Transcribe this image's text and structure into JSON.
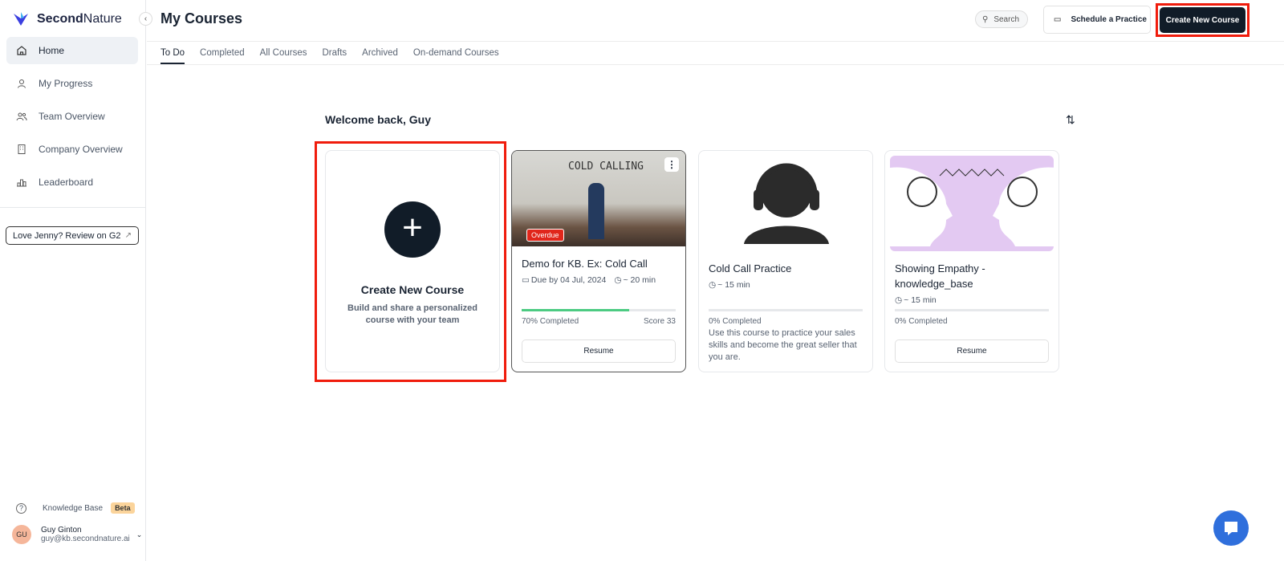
{
  "brand": {
    "name_bold": "Second",
    "name_rest": "Nature"
  },
  "sidebar": {
    "items": [
      {
        "label": "Home"
      },
      {
        "label": "My Progress"
      },
      {
        "label": "Team Overview"
      },
      {
        "label": "Company Overview"
      },
      {
        "label": "Leaderboard"
      }
    ],
    "review_label": "Love Jenny? Review on G2",
    "knowledge_base": "Knowledge Base",
    "beta": "Beta",
    "user": {
      "initials": "GU",
      "name": "Guy Ginton",
      "email": "guy@kb.secondnature.ai"
    }
  },
  "header": {
    "title": "My Courses",
    "search": "Search",
    "schedule": "Schedule a Practice",
    "create": "Create New Course"
  },
  "tabs": [
    {
      "label": "To Do"
    },
    {
      "label": "Completed"
    },
    {
      "label": "All Courses"
    },
    {
      "label": "Drafts"
    },
    {
      "label": "Archived"
    },
    {
      "label": "On-demand Courses"
    }
  ],
  "main": {
    "welcome": "Welcome back, Guy",
    "create_card": {
      "title": "Create New Course",
      "desc": "Build and share a personalized course with your team"
    },
    "courses": [
      {
        "title": "Demo for KB. Ex: Cold Call",
        "badge": "Overdue",
        "due": "Due by 04 Jul, 2024",
        "duration": "~ 20 min",
        "progress": 70,
        "progress_label": "70% Completed",
        "score": "Score 33",
        "button": "Resume",
        "image_text": "COLD CALLING"
      },
      {
        "title": "Cold Call Practice",
        "duration": "~ 15 min",
        "progress": 0,
        "progress_label": "0% Completed",
        "desc": "Use this course to practice your sales skills and become the great seller that you are."
      },
      {
        "title": "Showing Empathy - knowledge_base",
        "duration": "~ 15 min",
        "progress": 0,
        "progress_label": "0% Completed",
        "button": "Resume"
      }
    ]
  }
}
